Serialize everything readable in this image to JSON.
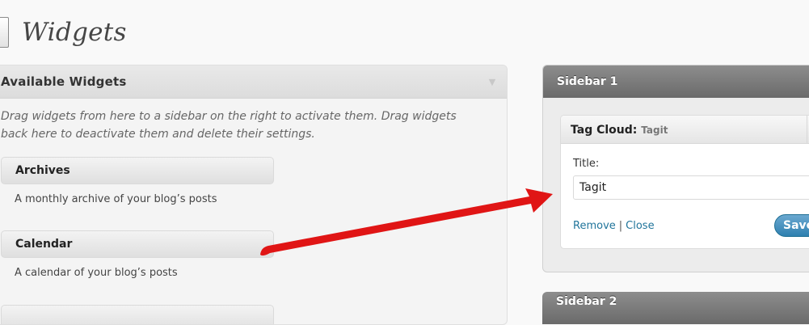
{
  "page": {
    "title": "Widgets"
  },
  "available": {
    "title": "Available Widgets",
    "description": "Drag widgets from here to a sidebar on the right to activate them. Drag widgets back here to deactivate them and delete their settings.",
    "widgets": [
      {
        "name": "Archives",
        "description": "A monthly archive of your blog’s posts"
      },
      {
        "name": "Calendar",
        "description": "A calendar of your blog’s posts"
      }
    ]
  },
  "sidebar1": {
    "title": "Sidebar 1",
    "widget": {
      "name": "Tag Cloud",
      "separator": ":",
      "subtitle": "Tagit",
      "title_label": "Title:",
      "title_value": "Tagit",
      "remove_label": "Remove",
      "links_separator": "|",
      "close_label": "Close",
      "save_label": "Save"
    }
  },
  "sidebar2": {
    "title": "Sidebar 2"
  },
  "colors": {
    "annotation_arrow": "#e01515",
    "link": "#21759b",
    "save_button": "#2f80b0"
  },
  "icons": {
    "page_icon": "widgets-page-icon",
    "toggle": "triangle-down-icon"
  }
}
